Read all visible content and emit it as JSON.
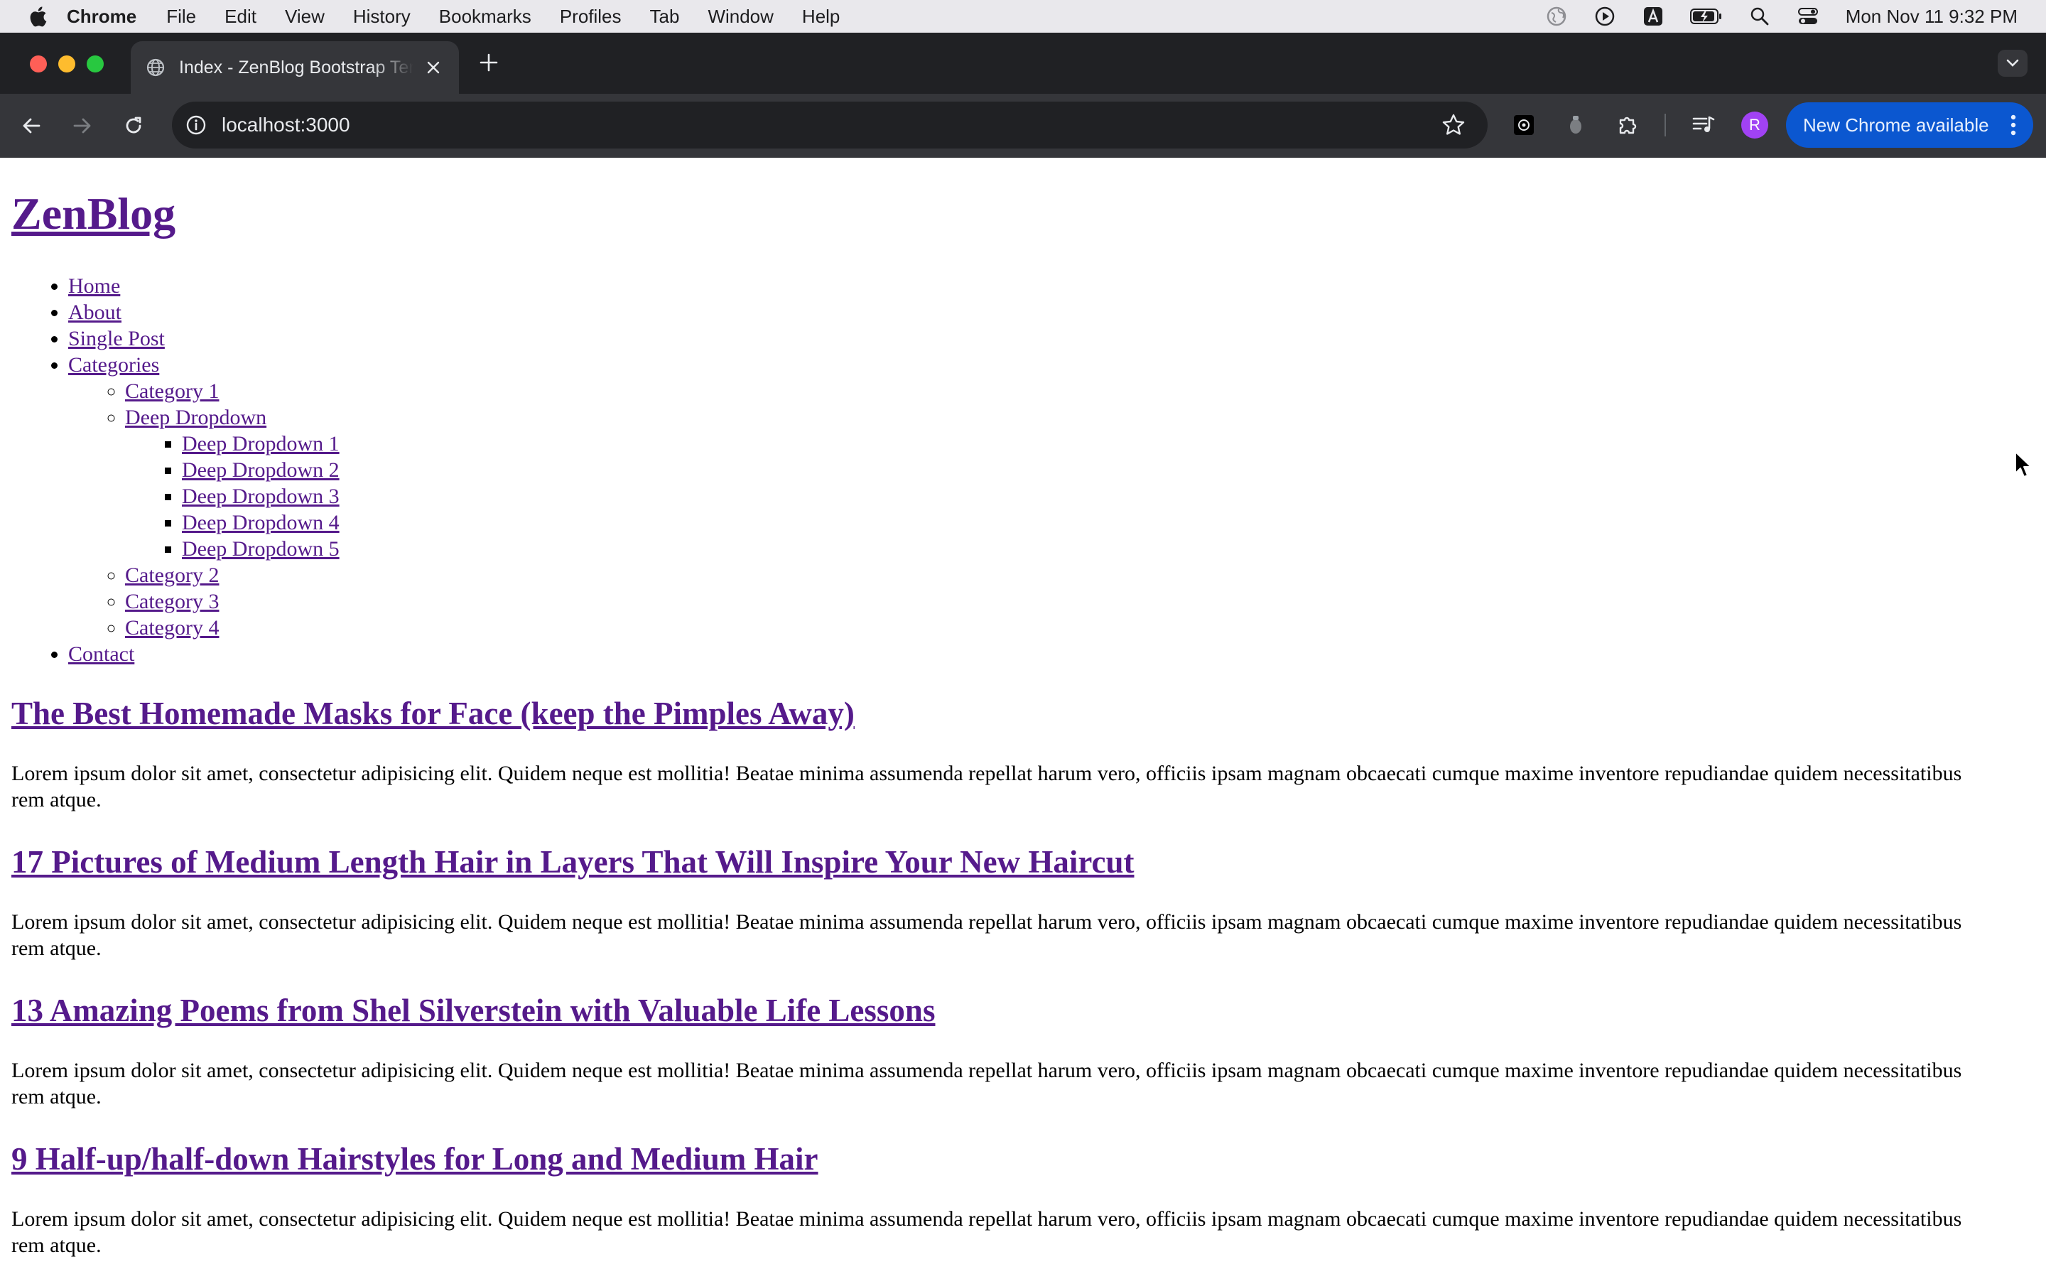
{
  "menubar": {
    "app_name": "Chrome",
    "items": [
      "File",
      "Edit",
      "View",
      "History",
      "Bookmarks",
      "Profiles",
      "Tab",
      "Window",
      "Help"
    ],
    "clock": "Mon Nov 11  9:32 PM",
    "status_icons": [
      "vpn-globe-icon",
      "play-circle-icon",
      "keyboard-a-icon",
      "battery-charging-icon",
      "spotlight-search-icon",
      "control-center-icon"
    ]
  },
  "browser": {
    "tab_title": "Index - ZenBlog Bootstrap Template",
    "url": "localhost:3000",
    "profile_initial": "R",
    "update_label": "New Chrome available",
    "colors": {
      "tabstrip": "#202124",
      "toolbar": "#35363a",
      "update_pill": "#0b57d0",
      "avatar": "#a142f4"
    }
  },
  "page": {
    "logo": "ZenBlog",
    "nav": {
      "home": "Home",
      "about": "About",
      "single_post": "Single Post",
      "categories": "Categories",
      "category_1": "Category 1",
      "deep_dropdown": "Deep Dropdown",
      "deep_items": [
        "Deep Dropdown 1",
        "Deep Dropdown 2",
        "Deep Dropdown 3",
        "Deep Dropdown 4",
        "Deep Dropdown 5"
      ],
      "category_2": "Category 2",
      "category_3": "Category 3",
      "category_4": "Category 4",
      "contact": "Contact"
    },
    "posts": [
      {
        "title": "The Best Homemade Masks for Face (keep the Pimples Away)",
        "excerpt": "Lorem ipsum dolor sit amet, consectetur adipisicing elit. Quidem neque est mollitia! Beatae minima assumenda repellat harum vero, officiis ipsam magnam obcaecati cumque maxime inventore repudiandae quidem necessitatibus rem atque."
      },
      {
        "title": "17 Pictures of Medium Length Hair in Layers That Will Inspire Your New Haircut",
        "excerpt": "Lorem ipsum dolor sit amet, consectetur adipisicing elit. Quidem neque est mollitia! Beatae minima assumenda repellat harum vero, officiis ipsam magnam obcaecati cumque maxime inventore repudiandae quidem necessitatibus rem atque."
      },
      {
        "title": "13 Amazing Poems from Shel Silverstein with Valuable Life Lessons",
        "excerpt": "Lorem ipsum dolor sit amet, consectetur adipisicing elit. Quidem neque est mollitia! Beatae minima assumenda repellat harum vero, officiis ipsam magnam obcaecati cumque maxime inventore repudiandae quidem necessitatibus rem atque."
      },
      {
        "title": "9 Half-up/half-down Hairstyles for Long and Medium Hair",
        "excerpt": "Lorem ipsum dolor sit amet, consectetur adipisicing elit. Quidem neque est mollitia! Beatae minima assumenda repellat harum vero, officiis ipsam magnam obcaecati cumque maxime inventore repudiandae quidem necessitatibus rem atque."
      }
    ],
    "link_color": "#551a8b"
  }
}
